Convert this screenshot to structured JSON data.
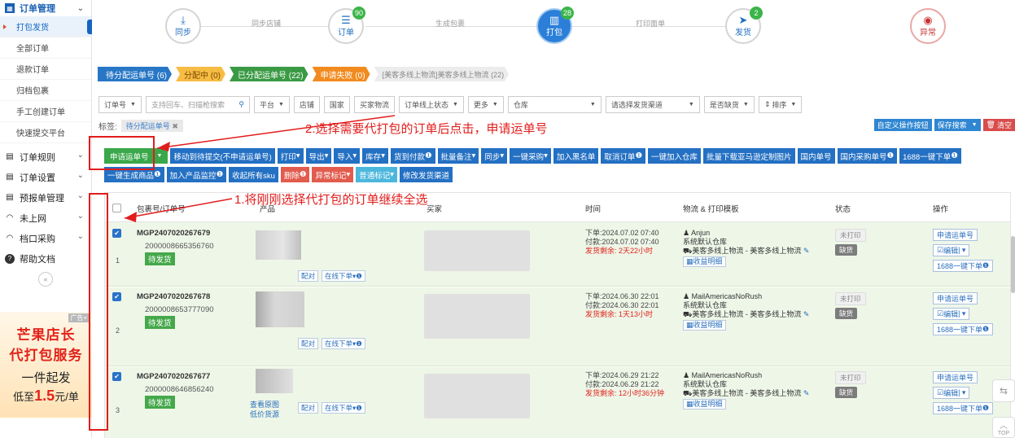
{
  "sidebar": {
    "group_order": "订单管理",
    "subitems": [
      "打包发货",
      "全部订单",
      "退款订单",
      "归档包裹",
      "手工创建订单",
      "快速提交平台"
    ],
    "groups": [
      "订单规则",
      "订单设置",
      "预报单管理",
      "未上网",
      "档口采购",
      "帮助文档"
    ],
    "collapse": "«",
    "ad": {
      "tag": "广告×",
      "line1": "芒果店长",
      "line2": "代打包服务",
      "line3": "一件起发",
      "line4_pre": "低至",
      "line4_price": "1.5",
      "line4_post": "元/单"
    }
  },
  "steps": [
    {
      "label": "同步",
      "icon": "download-icon",
      "badge": ""
    },
    {
      "label": "订单",
      "icon": "list-icon",
      "badge": "90"
    },
    {
      "label": "打包",
      "icon": "barcode-icon",
      "badge": "28"
    },
    {
      "label": "发货",
      "icon": "plane-icon",
      "badge": "2"
    },
    {
      "label": "异常",
      "icon": "eye-slash-icon",
      "badge": ""
    }
  ],
  "step_links": [
    "同步店铺",
    "生成包裹",
    "打印面单"
  ],
  "status_tabs": [
    "待分配运单号 (6)",
    "分配中 (0)",
    "已分配运单号 (22)",
    "申请失败 (0)",
    "[美客多线上物流]美客多线上物流 (22)"
  ],
  "filters": {
    "order_no": "订单号",
    "search_placeholder": "支持回车、扫描枪搜索",
    "platform": "平台",
    "shop": "店铺",
    "country": "国家",
    "buyer_logistics": "买家物流",
    "online_status": "订单线上状态",
    "more": "更多",
    "warehouse": "仓库",
    "channel": "请选择发货渠道",
    "stock": "是否缺货",
    "sort": "排序"
  },
  "tags": {
    "label": "标签:",
    "chip": "待分配运单号"
  },
  "right_buttons": [
    "自定义操作按钮",
    "保存搜索",
    "清空"
  ],
  "toolbar_row1": [
    "申请运单号",
    "移动到待提交(不申请运单号)",
    "打印",
    "导出",
    "导入",
    "库存",
    "货到付款",
    "批量备注",
    "同步",
    "一键采购",
    "加入黑名单",
    "取消订单",
    "一键加入仓库",
    "批量下载亚马逊定制图片",
    "国内单号",
    "国内采购单号",
    "1688一键下单"
  ],
  "toolbar_row2": [
    "一键生成商品",
    "加入产品监控",
    "收起所有sku",
    "删除",
    "异常标记",
    "普通标记",
    "修改发货渠道"
  ],
  "table": {
    "headers": [
      "包裹号/订单号",
      "产品",
      "买家",
      "时间",
      "物流 & 打印模板",
      "状态",
      "操作"
    ]
  },
  "orders": [
    {
      "idx": "1",
      "package": "MGP2407020267679",
      "order": "2000008665356760",
      "status_tag": "待发货",
      "t1": "下单:2024.07.02 07:40",
      "t2": "付款:2024.07.02 07:40",
      "t3": "发货剩余: 2天22小时",
      "carrier": "Anjun",
      "warehouse": "系统默认仓库",
      "channel": "美客多线上物流 - 美客多线上物流",
      "profit": "收益明细",
      "print": "未打印",
      "stock": "缺货",
      "links": []
    },
    {
      "idx": "2",
      "package": "MGP2407020267678",
      "order": "2000008653777090",
      "status_tag": "待发货",
      "t1": "下单:2024.06.30 22:01",
      "t2": "付款:2024.06.30 22:01",
      "t3": "发货剩余: 1天13小时",
      "carrier": "MailAmericasNoRush",
      "warehouse": "系统默认仓库",
      "channel": "美客多线上物流 - 美客多线上物流",
      "profit": "收益明细",
      "print": "未打印",
      "stock": "缺货",
      "links": []
    },
    {
      "idx": "3",
      "package": "MGP2407020267677",
      "order": "2000008646856240",
      "status_tag": "待发货",
      "t1": "下单:2024.06.29 21:22",
      "t2": "付款:2024.06.29 21:22",
      "t3": "发货剩余: 12小时36分钟",
      "carrier": "MailAmericasNoRush",
      "warehouse": "系统默认仓库",
      "channel": "美客多线上物流 - 美客多线上物流",
      "profit": "收益明细",
      "print": "未打印",
      "stock": "缺货",
      "links": [
        "查看原图",
        "低价货源"
      ]
    }
  ],
  "row_buttons": {
    "match": "配对",
    "online_order": "在线下单",
    "apply": "申请运单号",
    "edit": "编辑",
    "one_click": "1688一键下单"
  },
  "annotations": {
    "step2": "2.选择需要代打包的订单后点击，申请运单号",
    "step1": "1.将刚刚选择代打包的订单继续全选"
  },
  "floats": {
    "top": "TOP"
  },
  "colors": {
    "primary": "#2470c3",
    "green": "#3aa84a",
    "annotation": "#e21c1c"
  }
}
